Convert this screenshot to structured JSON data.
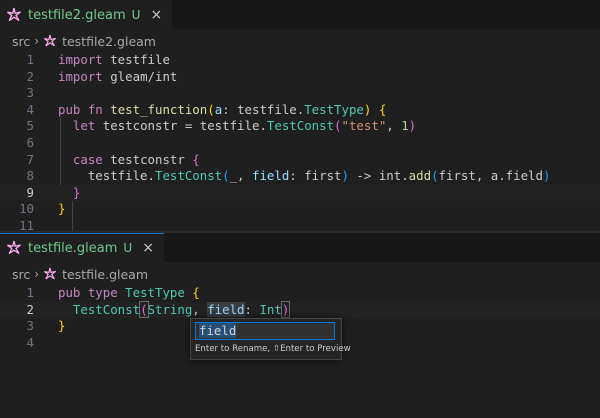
{
  "top": {
    "tab": {
      "filename": "testfile2.gleam",
      "badge": "U",
      "close": "×"
    },
    "breadcrumb": {
      "folder": "src",
      "file": "testfile2.gleam"
    },
    "lines": [
      "1",
      "2",
      "3",
      "4",
      "5",
      "6",
      "7",
      "8",
      "9",
      "10",
      "11"
    ],
    "code": {
      "l1_kw": "import",
      "l1_mod": " testfile",
      "l2_kw": "import",
      "l2_mod": " gleam/int",
      "l4_pub": "pub",
      "l4_fn": " fn ",
      "l4_name": "test_function",
      "l4_p1": "(",
      "l4_arg": "a",
      "l4_colon": ": testfile.",
      "l4_type": "TestType",
      "l4_p2": ")",
      "l4_brace": " {",
      "l5_let": "let",
      "l5_var": " testconstr",
      "l5_eq": " = testfile.",
      "l5_ctor": "TestConst",
      "l5_p1": "(",
      "l5_str": "\"test\"",
      "l5_comma": ", ",
      "l5_num": "1",
      "l5_p2": ")",
      "l7_case": "case",
      "l7_var": " testconstr ",
      "l7_brace": "{",
      "l8_mod": "testfile.",
      "l8_ctor": "TestConst",
      "l8_p1": "(",
      "l8_pre": "_, ",
      "l8_field": "field",
      "l8_mid": ": first",
      "l8_p2": ")",
      "l8_arrow": " -> int.",
      "l8_fn": "add",
      "l8_p3": "(",
      "l8_args": "first, a.field",
      "l8_p4": ")",
      "l9_brace": "}",
      "l10_brace": "}"
    }
  },
  "bottom": {
    "tab": {
      "filename": "testfile.gleam",
      "badge": "U",
      "close": "×"
    },
    "breadcrumb": {
      "folder": "src",
      "file": "testfile.gleam"
    },
    "lines": [
      "1",
      "2",
      "3",
      "4"
    ],
    "code": {
      "l1_pub": "pub",
      "l1_type": " type ",
      "l1_name": "TestType",
      "l1_brace": " {",
      "l2_ctor": "TestConst",
      "l2_p1": "(",
      "l2_t1": "String",
      "l2_comma": ", ",
      "l2_field": "field",
      "l2_colon": ": ",
      "l2_t2": "Int",
      "l2_p2": ")",
      "l3_brace": "}"
    }
  },
  "rename": {
    "value": "field",
    "hint": "Enter to Rename, ⇧Enter to Preview"
  },
  "colors": {
    "accent": "#0078d4",
    "untracked": "#73c991",
    "gleam_icon": "#ffaff3"
  }
}
